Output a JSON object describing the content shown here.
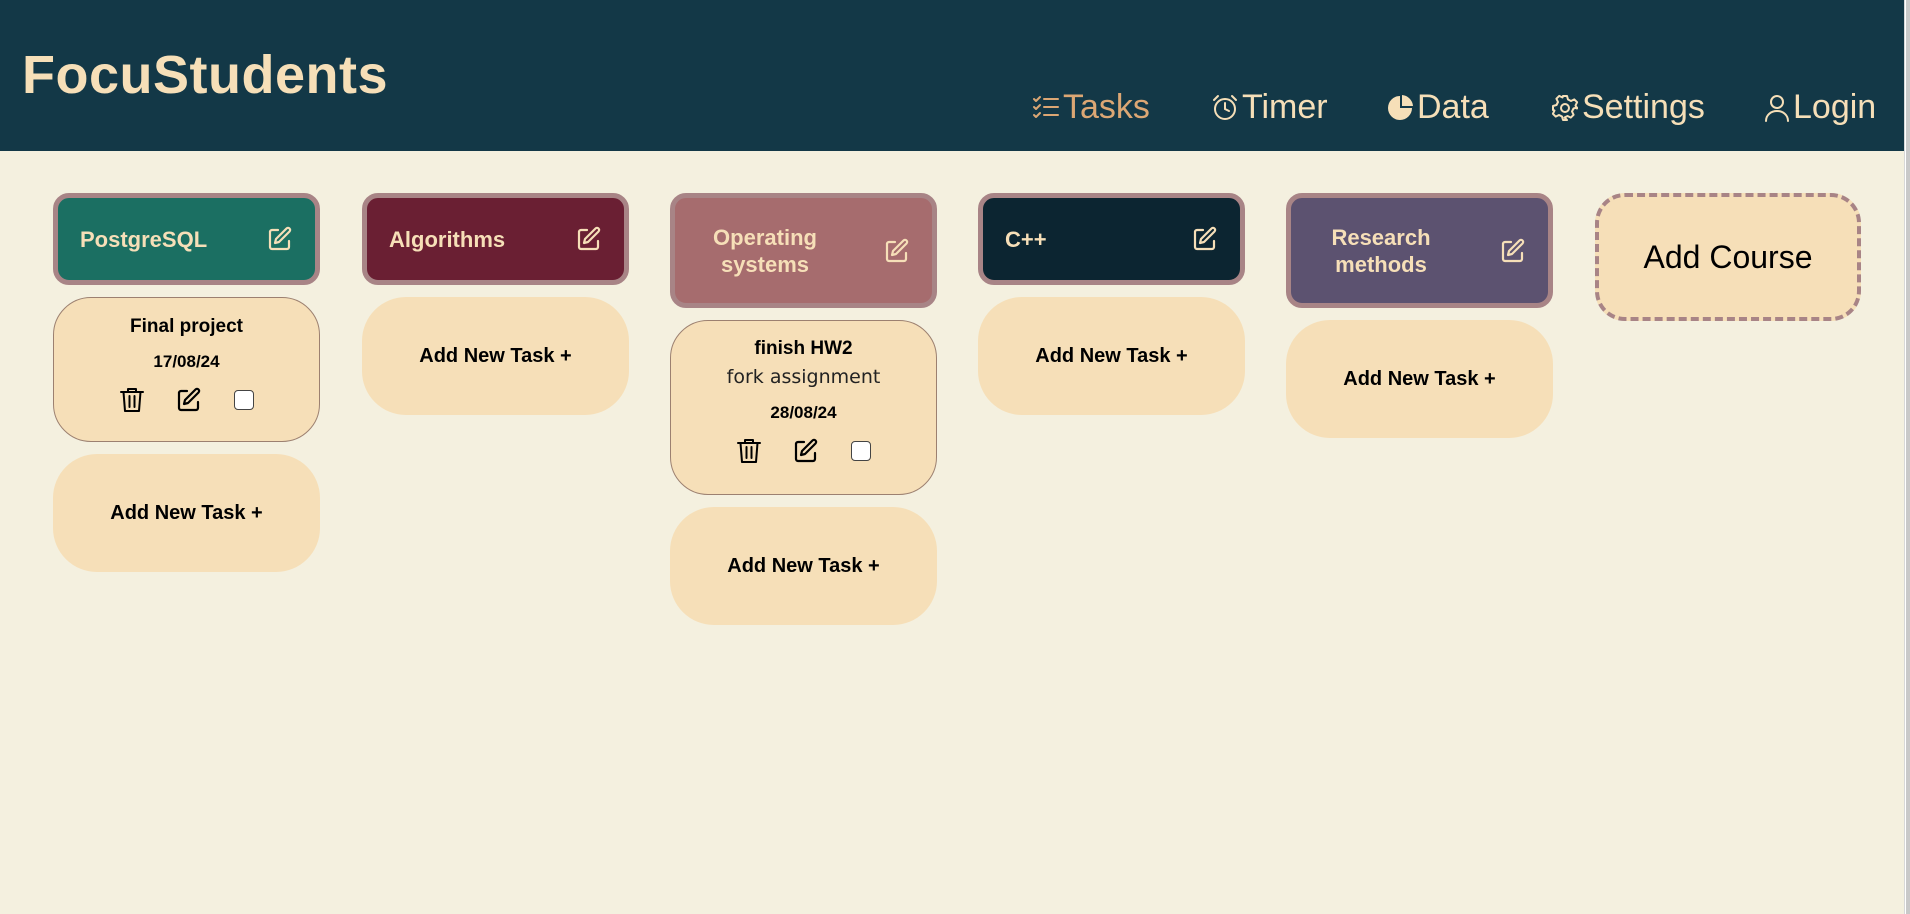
{
  "app": {
    "title": "FocuStudents"
  },
  "nav": {
    "tasks": "Tasks",
    "timer": "Timer",
    "data": "Data",
    "settings": "Settings",
    "login": "Login"
  },
  "colors": {
    "header_bg": "#133847",
    "page_bg": "#f4f0df",
    "accent_text": "#f6dfb8",
    "active_nav": "#dca774",
    "card_bg": "#f6dfb8",
    "course_border": "#a88486"
  },
  "icons": {
    "tasks": "checklist-icon",
    "timer": "alarm-clock-icon",
    "data": "pie-chart-icon",
    "settings": "gear-icon",
    "login": "user-icon",
    "edit": "edit-icon",
    "delete": "trash-icon"
  },
  "courses": [
    {
      "name": "PostgreSQL",
      "color": "#1b6f62",
      "tasks": [
        {
          "title": "Final project",
          "description": "",
          "date": "17/08/24"
        }
      ],
      "add_task_label": "Add New Task +"
    },
    {
      "name": "Algorithms",
      "color": "#6a1f33",
      "tasks": [],
      "add_task_label": "Add New Task +"
    },
    {
      "name": "Operating systems",
      "color": "#a66c6e",
      "tasks": [
        {
          "title": "finish HW2",
          "description": "fork assignment",
          "date": "28/08/24"
        }
      ],
      "add_task_label": "Add New Task +"
    },
    {
      "name": "C++",
      "color": "#0c2531",
      "tasks": [],
      "add_task_label": "Add New Task +"
    },
    {
      "name": "Research methods",
      "color": "#5c5270",
      "tasks": [],
      "add_task_label": "Add New Task +"
    }
  ],
  "add_course_label": "Add Course"
}
